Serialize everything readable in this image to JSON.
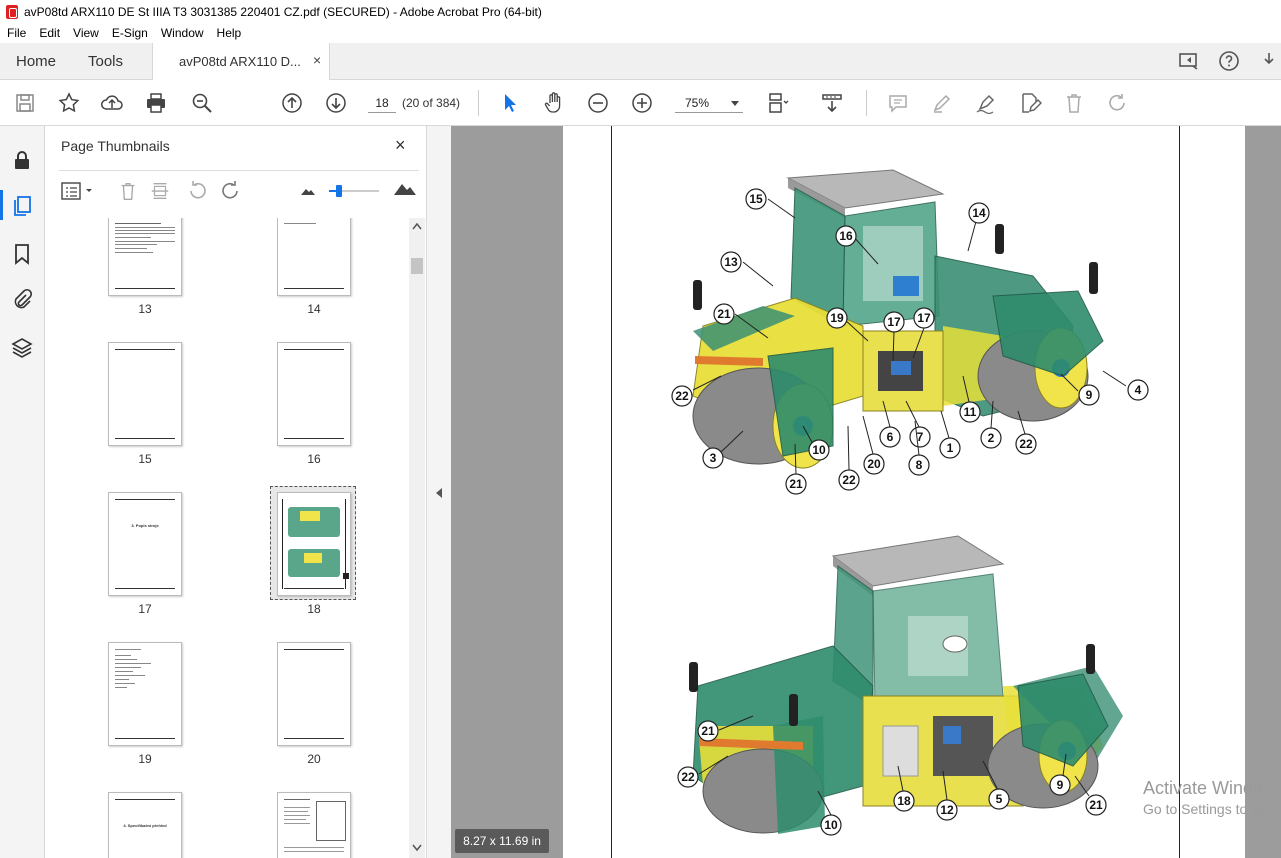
{
  "window": {
    "title": "avP08td ARX110 DE St IIIA T3 3031385 220401 CZ.pdf (SECURED) - Adobe Acrobat Pro (64-bit)"
  },
  "menu": [
    "File",
    "Edit",
    "View",
    "E-Sign",
    "Window",
    "Help"
  ],
  "tabs": {
    "home": "Home",
    "tools": "Tools",
    "document": "avP08td ARX110 D...",
    "close": "×"
  },
  "toolbar": {
    "page_current": "18",
    "page_of": "(20 of 384)",
    "zoom": "75%"
  },
  "panel": {
    "title": "Page Thumbnails",
    "close": "×",
    "thumbnails": [
      {
        "label": "13"
      },
      {
        "label": "14"
      },
      {
        "label": "15"
      },
      {
        "label": "16"
      },
      {
        "label": "17",
        "heading": "3. Popis stroje"
      },
      {
        "label": "18",
        "selected": true
      },
      {
        "label": "19"
      },
      {
        "label": "20"
      },
      {
        "label": "",
        "heading": "4. Specifikační přehled"
      },
      {
        "label": ""
      }
    ]
  },
  "document": {
    "page_size": "8.27 x 11.69 in",
    "callouts_top": [
      "15",
      "14",
      "16",
      "13",
      "21",
      "19",
      "17",
      "17",
      "22",
      "9",
      "4",
      "11",
      "2",
      "22",
      "6",
      "7",
      "1",
      "3",
      "10",
      "8",
      "20",
      "22",
      "21"
    ],
    "callouts_bottom": [
      "21",
      "22",
      "9",
      "21",
      "18",
      "12",
      "5",
      "10"
    ]
  },
  "watermark": {
    "line1": "Activate Windo",
    "line2": "Go to Settings to ac"
  },
  "colors": {
    "accent": "#1473e6",
    "machine_green": "#2f8a6a",
    "machine_yellow": "#f2e53a"
  }
}
